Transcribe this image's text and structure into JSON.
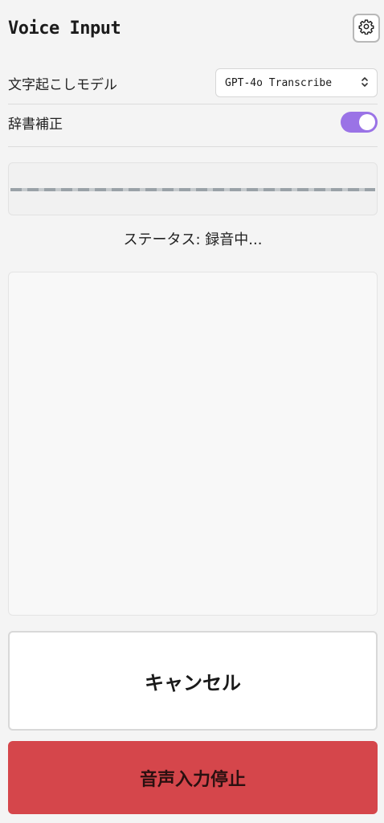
{
  "header": {
    "title": "Voice Input",
    "settings_icon": "gear-icon"
  },
  "settings": {
    "model_label": "文字起こしモデル",
    "model_value": "GPT-4o Transcribe",
    "dictionary_label": "辞書補正",
    "dictionary_enabled": true
  },
  "status": {
    "text": "ステータス: 録音中..."
  },
  "transcript": {
    "text": ""
  },
  "buttons": {
    "cancel_label": "キャンセル",
    "stop_label": "音声入力停止"
  },
  "colors": {
    "toggle_on": "#9a73e6",
    "stop_button": "#d5464b",
    "background": "#f4f4f4"
  }
}
